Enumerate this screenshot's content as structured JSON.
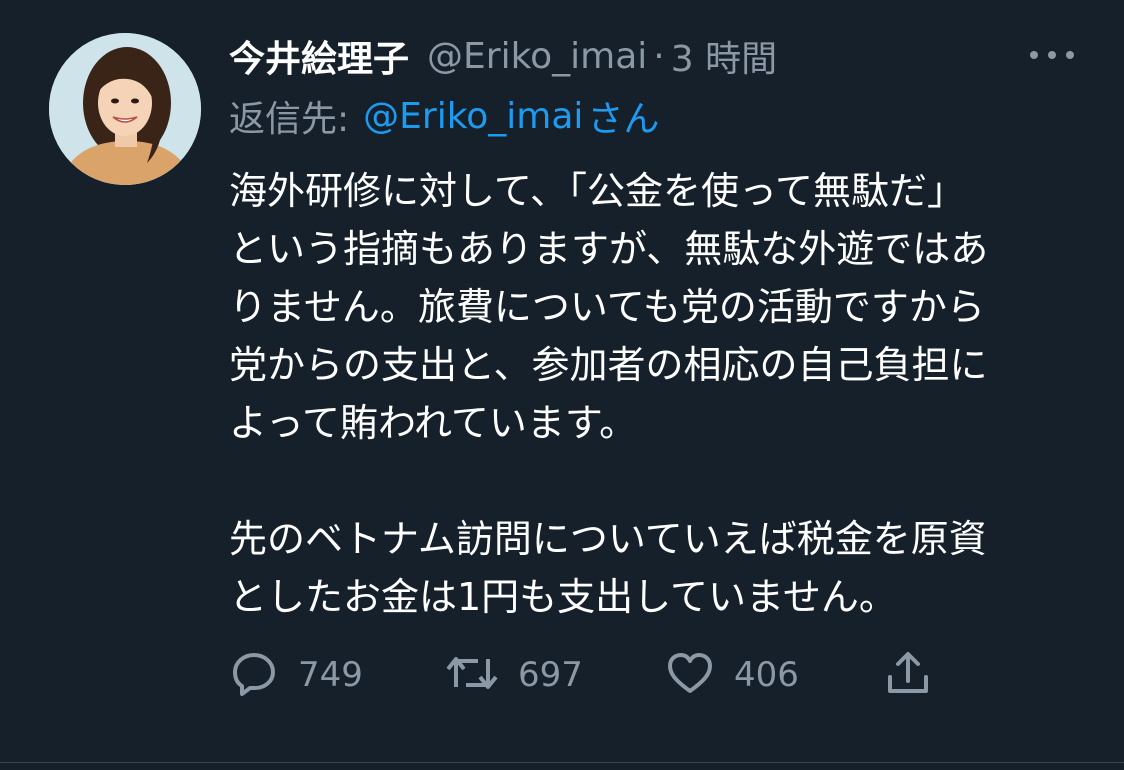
{
  "tweet": {
    "author_name": "今井絵理子",
    "author_handle": "@Eriko_imai",
    "separator": "·",
    "time": "3 時間",
    "reply_prefix": "返信先:",
    "reply_handle": "@Eriko_imai",
    "reply_suffix": "さん",
    "paragraphs": [
      [
        "海外研修に対して、「公金を使って無駄だ」",
        "という指摘もありますが、無駄な外遊ではあ",
        "りません。旅費についても党の活動ですから",
        "党からの支出と、参加者の相応の自己負担に",
        "よって賄われています。"
      ],
      [
        "先のベトナム訪問についていえば税金を原資",
        "としたお金は1円も支出していません。"
      ]
    ],
    "actions": {
      "reply_count": "749",
      "retweet_count": "697",
      "like_count": "406"
    }
  },
  "icons": {
    "more": "more-icon",
    "reply": "reply-icon",
    "retweet": "retweet-icon",
    "like": "heart-icon",
    "share": "share-icon"
  },
  "colors": {
    "background": "#15202b",
    "primary_text": "#ffffff",
    "secondary_text": "#8b98a5",
    "link": "#1d9bf0"
  }
}
